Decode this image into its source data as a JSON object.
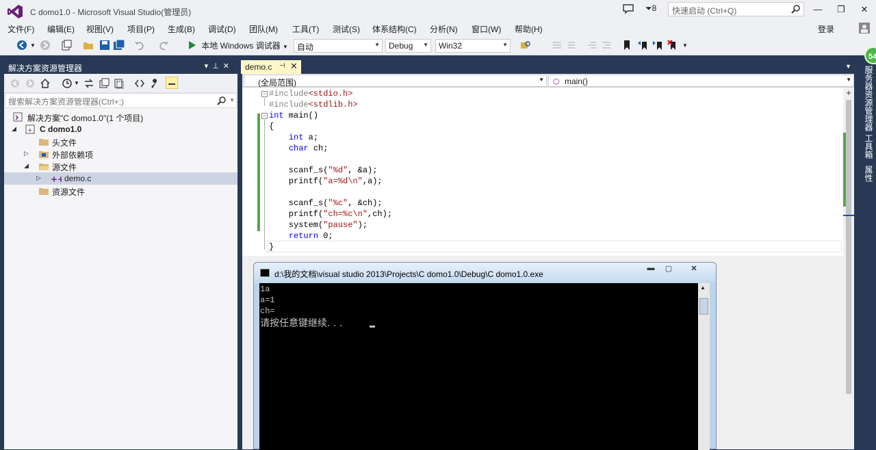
{
  "window": {
    "title": "C domo1.0 - Microsoft Visual Studio(管理员)"
  },
  "titlebar": {
    "filter_count": "8",
    "quick_launch_placeholder": "快速启动 (Ctrl+Q)",
    "minimize": "—",
    "restore": "❐",
    "close": "✕"
  },
  "menu": {
    "items": [
      "文件(F)",
      "编辑(E)",
      "视图(V)",
      "项目(P)",
      "生成(B)",
      "调试(D)",
      "团队(M)",
      "工具(T)",
      "测试(S)",
      "体系结构(C)",
      "分析(N)",
      "窗口(W)",
      "帮助(H)"
    ],
    "login": "登录"
  },
  "toolbar": {
    "run_label": "本地 Windows 调试器",
    "config1": "自动",
    "config2": "Debug",
    "platform": "Win32"
  },
  "solution_explorer": {
    "title": "解决方案资源管理器",
    "search_placeholder": "搜索解决方案资源管理器(Ctrl+;)",
    "tree": [
      {
        "label": "解决方案\"C domo1.0\"(1 个项目)"
      },
      {
        "label": "C domo1.0"
      },
      {
        "label": "头文件"
      },
      {
        "label": "外部依赖项"
      },
      {
        "label": "源文件"
      },
      {
        "label": "demo.c"
      },
      {
        "label": "资源文件"
      }
    ]
  },
  "editor": {
    "tab_label": "demo.c",
    "scope_left": "(全局范围)",
    "scope_right": "main()",
    "code": [
      [
        "#include",
        "<stdio.h>"
      ],
      [
        "#include",
        "<stdlib.h>"
      ],
      [
        "int",
        " main()"
      ],
      [
        "{"
      ],
      [
        "    ",
        "int",
        " a;"
      ],
      [
        "    ",
        "char",
        " ch;"
      ],
      [
        ""
      ],
      [
        "    scanf_s(",
        "\"%d\"",
        ", &a);"
      ],
      [
        "    printf(",
        "\"a=%d\\n\"",
        ",a);"
      ],
      [
        ""
      ],
      [
        "    scanf_s(",
        "\"%c\"",
        ", &ch);"
      ],
      [
        "    printf(",
        "\"ch=%c\\n\"",
        ",ch);"
      ],
      [
        "    system(",
        "\"pause\"",
        ");"
      ],
      [
        "    ",
        "return",
        " 0;"
      ],
      [
        "}"
      ]
    ]
  },
  "right_rail": {
    "items": [
      "服务器资源管理器",
      "工具箱",
      "属性"
    ],
    "badge": "54"
  },
  "console": {
    "title": "d:\\我的文档\\visual studio 2013\\Projects\\C domo1.0\\Debug\\C domo1.0.exe",
    "lines": [
      "1a",
      "a=1",
      "ch=",
      "请按任意键继续. . . "
    ],
    "minimize": "▬",
    "maximize": "▢",
    "close": "✕"
  }
}
